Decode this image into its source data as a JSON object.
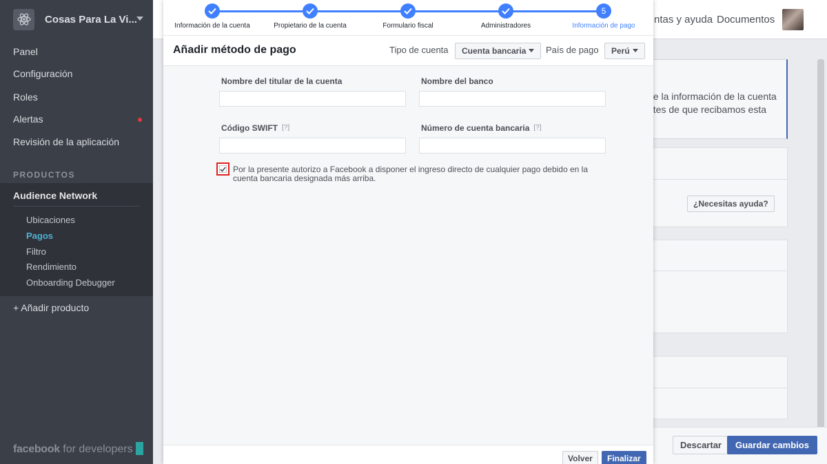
{
  "sidebar": {
    "app_name": "Cosas Para La Vi...",
    "app_icon": "atom-icon",
    "nav": [
      "Panel",
      "Configuración",
      "Roles",
      "Alertas",
      "Revisión de la aplicación"
    ],
    "products_title": "PRODUCTOS",
    "product_name": "Audience Network",
    "sub_items": [
      "Ubicaciones",
      "Pagos",
      "Filtro",
      "Rendimiento",
      "Onboarding Debugger"
    ],
    "active_sub_item": "Pagos",
    "add_product": "+ Añadir producto",
    "brand_strong": "facebook",
    "brand_light": " for developers",
    "alert_color": "#e0393e",
    "accent_color": "#4fb2d6"
  },
  "background": {
    "topbar_links": [
      "ntas y ayuda",
      "Documentos"
    ],
    "info_text_line1": "ne la información de la cuenta",
    "info_text_line2": "ntes de que recibamos esta",
    "help_button": "¿Necesitas ayuda?",
    "discard_button": "Descartar",
    "save_button": "Guardar cambios"
  },
  "modal": {
    "steps": [
      {
        "label": "Información de la cuenta",
        "state": "done"
      },
      {
        "label": "Propietario de la cuenta",
        "state": "done"
      },
      {
        "label": "Formulario fiscal",
        "state": "done"
      },
      {
        "label": "Administradores",
        "state": "done"
      },
      {
        "label": "Información de pago",
        "state": "current",
        "number": "5"
      }
    ],
    "title": "Añadir método de pago",
    "account_type_label": "Tipo de cuenta",
    "account_type_value": "Cuenta bancaria",
    "country_label": "País de pago",
    "country_value": "Perú",
    "fields": {
      "holder_label": "Nombre del titular de la cuenta",
      "holder_value": "",
      "bank_label": "Nombre del banco",
      "bank_value": "",
      "swift_label": "Código SWIFT",
      "swift_help": "[?]",
      "swift_value": "",
      "account_label": "Número de cuenta bancaria",
      "account_help": "[?]",
      "account_value": ""
    },
    "consent_checked": true,
    "consent_text": "Por la presente autorizo a Facebook a disponer el ingreso directo de cualquier pago debido en la cuenta bancaria designada más arriba.",
    "back_button": "Volver",
    "finish_button": "Finalizar",
    "step_color": "#4080ff",
    "primary_color": "#4267b2"
  }
}
